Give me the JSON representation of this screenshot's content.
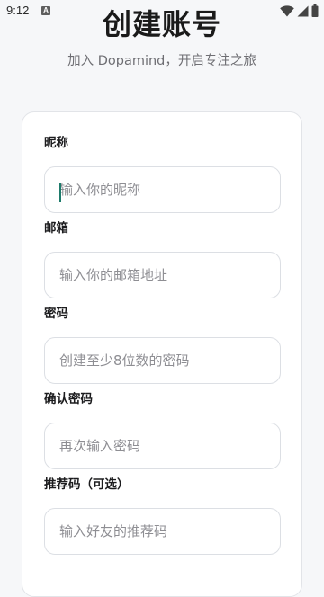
{
  "status_bar": {
    "time": "9:12",
    "notification_badge": "A",
    "icons": [
      "wifi-icon",
      "signal-icon",
      "battery-icon"
    ]
  },
  "header": {
    "title": "创建账号",
    "subtitle": "加入 Dopamind，开启专注之旅"
  },
  "form": {
    "fields": [
      {
        "label": "昵称",
        "placeholder": "输入你的昵称",
        "value": ""
      },
      {
        "label": "邮箱",
        "placeholder": "输入你的邮箱地址",
        "value": ""
      },
      {
        "label": "密码",
        "placeholder": "创建至少8位数的密码",
        "value": ""
      },
      {
        "label": "确认密码",
        "placeholder": "再次输入密码",
        "value": ""
      },
      {
        "label": "推荐码（可选）",
        "placeholder": "输入好友的推荐码",
        "value": ""
      }
    ]
  },
  "colors": {
    "background": "#f6f7f9",
    "card": "#ffffff",
    "accent_caret": "#1e7b6b",
    "placeholder": "#8e8e93"
  }
}
